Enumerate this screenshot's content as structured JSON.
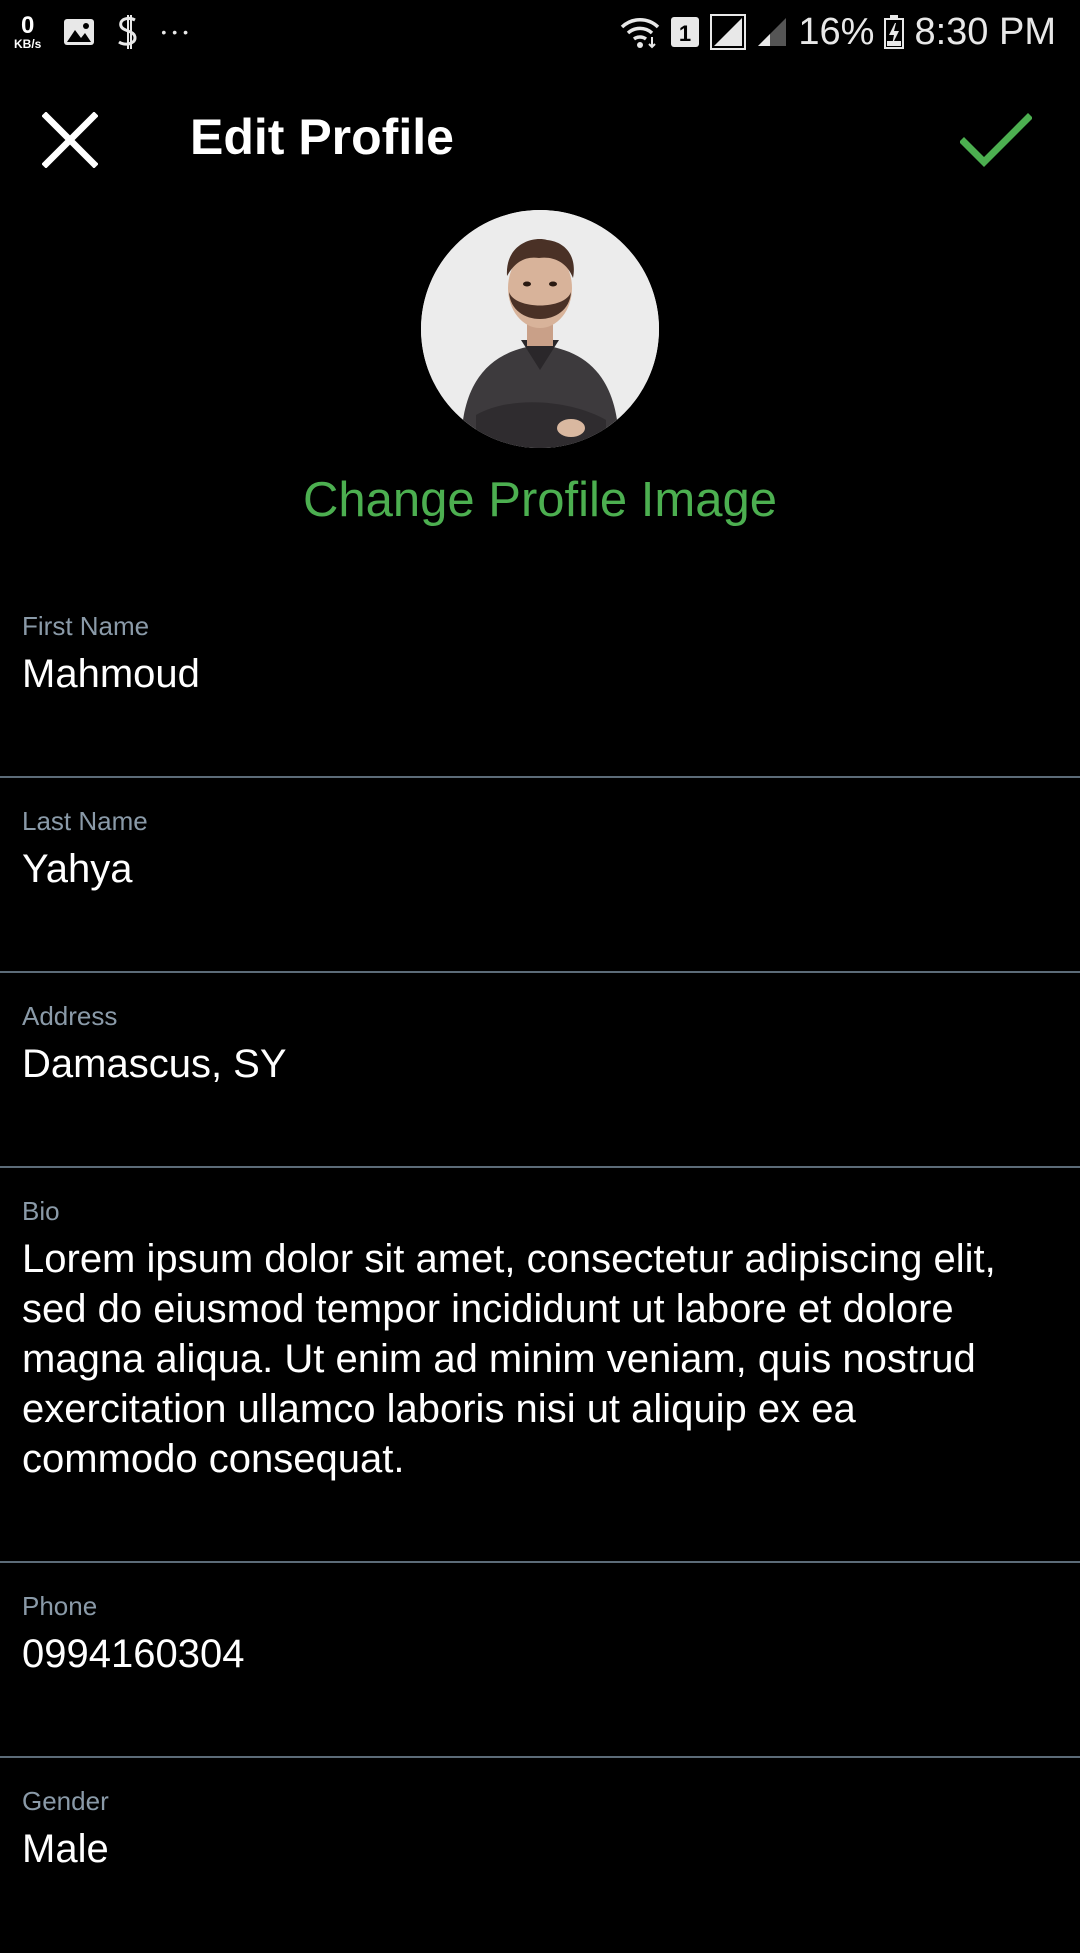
{
  "status_bar": {
    "kbs_value": "0",
    "kbs_unit": "KB/s",
    "more_dots": "•••",
    "sim_number": "1",
    "battery_percent": "16%",
    "time": "8:30 PM"
  },
  "header": {
    "title": "Edit Profile"
  },
  "profile": {
    "change_image_label": "Change Profile Image"
  },
  "fields": {
    "first_name": {
      "label": "First Name",
      "value": "Mahmoud"
    },
    "last_name": {
      "label": "Last Name",
      "value": "Yahya"
    },
    "address": {
      "label": "Address",
      "value": "Damascus, SY"
    },
    "bio": {
      "label": "Bio",
      "value": "Lorem ipsum dolor sit amet, consectetur adipiscing elit, sed do eiusmod tempor incididunt ut labore et dolore magna aliqua. Ut enim ad minim veniam, quis nostrud exercitation ullamco laboris nisi ut aliquip ex ea commodo consequat."
    },
    "phone": {
      "label": "Phone",
      "value": "0994160304"
    },
    "gender": {
      "label": "Gender",
      "value": "Male"
    }
  },
  "colors": {
    "background": "#000000",
    "accent_green": "#4caf50",
    "label_gray": "#8a9aa8",
    "divider": "#5c6b78"
  },
  "icons": {
    "close": "close-icon",
    "save": "checkmark-icon",
    "status_left": [
      "gallery-icon",
      "money-app-icon",
      "more-dots-icon"
    ],
    "status_right": [
      "wifi-icon",
      "sim-badge-icon",
      "signal-icon",
      "signal-icon",
      "battery-icon"
    ]
  }
}
